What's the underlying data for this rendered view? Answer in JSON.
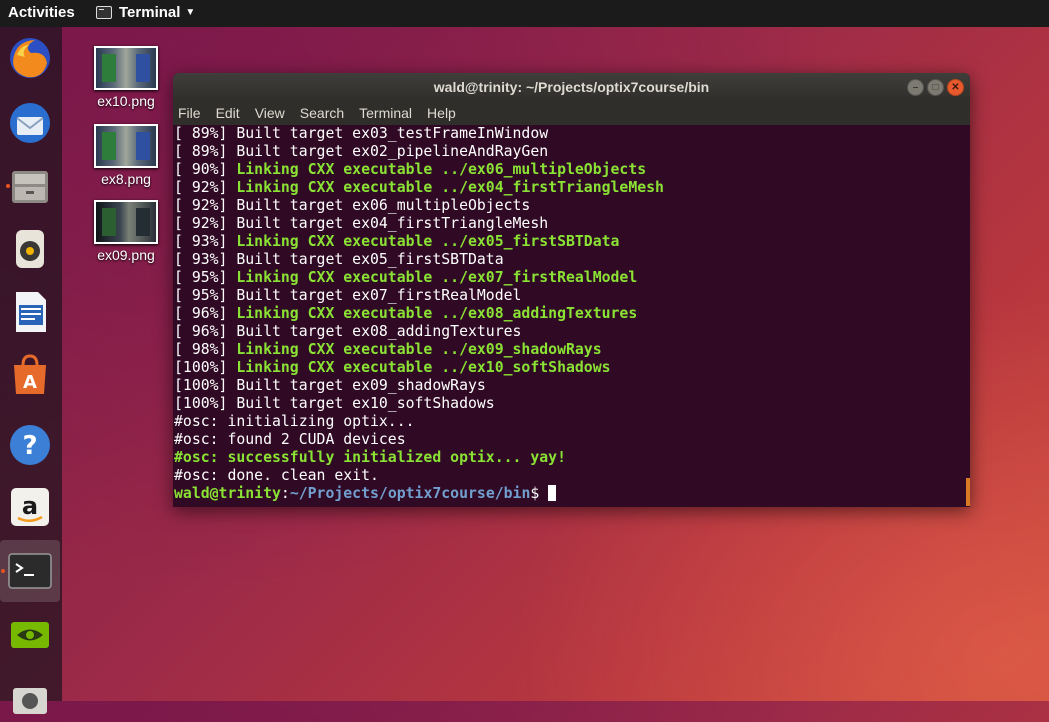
{
  "topbar": {
    "activities": "Activities",
    "app_name": "Terminal"
  },
  "dock": {
    "items": [
      {
        "name": "firefox-icon"
      },
      {
        "name": "thunderbird-icon"
      },
      {
        "name": "files-icon"
      },
      {
        "name": "rhythmbox-icon"
      },
      {
        "name": "writer-icon"
      },
      {
        "name": "software-center-icon"
      },
      {
        "name": "help-icon"
      },
      {
        "name": "amazon-icon"
      },
      {
        "name": "terminal-icon"
      },
      {
        "name": "nvidia-icon"
      },
      {
        "name": "camera-icon"
      }
    ]
  },
  "desktop": {
    "files": [
      {
        "label": "ex10.png"
      },
      {
        "label": "ex8.png"
      },
      {
        "label": "ex09.png"
      }
    ]
  },
  "window": {
    "title": "wald@trinity: ~/Projects/optix7course/bin",
    "menu": [
      "File",
      "Edit",
      "View",
      "Search",
      "Terminal",
      "Help"
    ]
  },
  "terminal": {
    "lines": [
      {
        "prefix": "[ 89%] ",
        "text": "Built target ex03_testFrameInWindow",
        "style": "normal"
      },
      {
        "prefix": "[ 89%] ",
        "text": "Built target ex02_pipelineAndRayGen",
        "style": "normal"
      },
      {
        "prefix": "[ 90%] ",
        "text": "Linking CXX executable ../ex06_multipleObjects",
        "style": "green"
      },
      {
        "prefix": "[ 92%] ",
        "text": "Linking CXX executable ../ex04_firstTriangleMesh",
        "style": "green"
      },
      {
        "prefix": "[ 92%] ",
        "text": "Built target ex06_multipleObjects",
        "style": "normal"
      },
      {
        "prefix": "[ 92%] ",
        "text": "Built target ex04_firstTriangleMesh",
        "style": "normal"
      },
      {
        "prefix": "[ 93%] ",
        "text": "Linking CXX executable ../ex05_firstSBTData",
        "style": "green"
      },
      {
        "prefix": "[ 93%] ",
        "text": "Built target ex05_firstSBTData",
        "style": "normal"
      },
      {
        "prefix": "[ 95%] ",
        "text": "Linking CXX executable ../ex07_firstRealModel",
        "style": "green"
      },
      {
        "prefix": "[ 95%] ",
        "text": "Built target ex07_firstRealModel",
        "style": "normal"
      },
      {
        "prefix": "[ 96%] ",
        "text": "Linking CXX executable ../ex08_addingTextures",
        "style": "green"
      },
      {
        "prefix": "[ 96%] ",
        "text": "Built target ex08_addingTextures",
        "style": "normal"
      },
      {
        "prefix": "[ 98%] ",
        "text": "Linking CXX executable ../ex09_shadowRays",
        "style": "green"
      },
      {
        "prefix": "[100%] ",
        "text": "Linking CXX executable ../ex10_softShadows",
        "style": "green"
      },
      {
        "prefix": "[100%] ",
        "text": "Built target ex09_shadowRays",
        "style": "normal"
      },
      {
        "prefix": "[100%] ",
        "text": "Built target ex10_softShadows",
        "style": "normal"
      },
      {
        "prefix": "#osc: ",
        "text": "initializing optix...",
        "style": "normal"
      },
      {
        "prefix": "#osc: ",
        "text": "found 2 CUDA devices",
        "style": "normal"
      },
      {
        "prefix": "",
        "text": "#osc: successfully initialized optix... yay!",
        "style": "green"
      },
      {
        "prefix": "#osc: ",
        "text": "done. clean exit.",
        "style": "normal"
      }
    ],
    "prompt": {
      "user_host": "wald@trinity",
      "sep": ":",
      "path": "~/Projects/optix7course/bin",
      "symbol": "$ "
    }
  },
  "colors": {
    "terminal_bg": "#300a24",
    "green": "#8ae234",
    "blue": "#729fcf",
    "accent": "#e95420"
  }
}
